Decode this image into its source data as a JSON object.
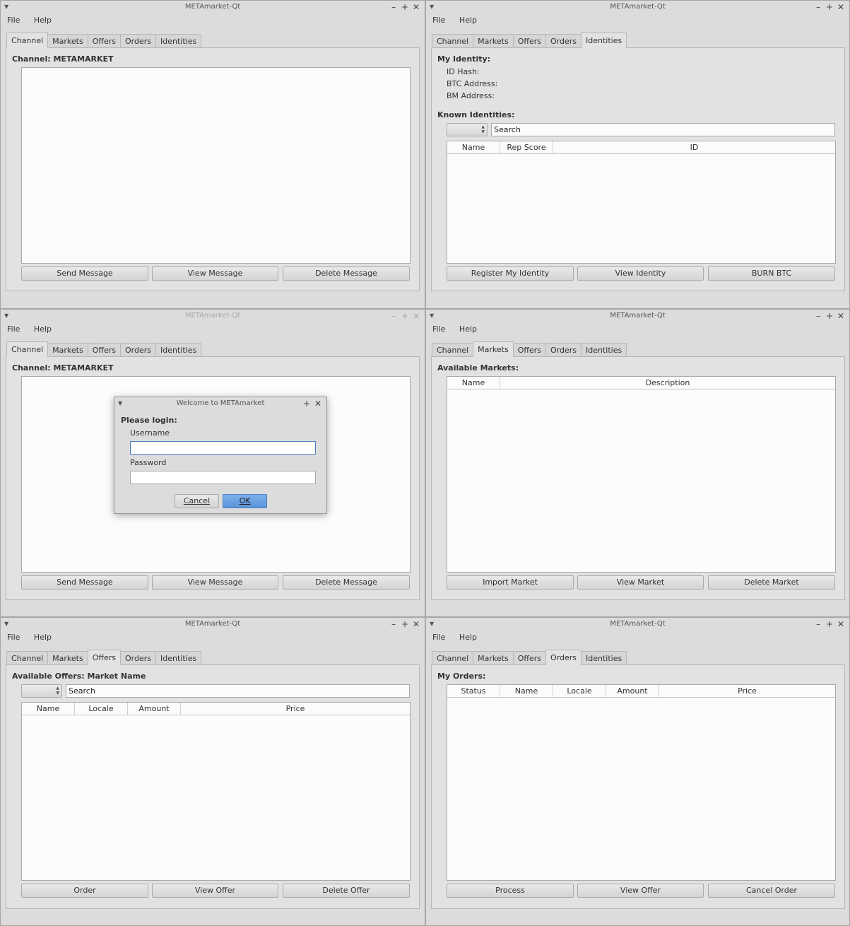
{
  "app_title": "METAmarket-Qt",
  "menu": {
    "file": "File",
    "help": "Help"
  },
  "tabs": {
    "channel": "Channel",
    "markets": "Markets",
    "offers": "Offers",
    "orders": "Orders",
    "identities": "Identities"
  },
  "channel": {
    "title": "Channel: METAMARKET",
    "buttons": {
      "send": "Send Message",
      "view": "View Message",
      "delete": "Delete Message"
    }
  },
  "identities": {
    "my_identity": "My Identity:",
    "id_hash": "ID Hash:",
    "btc_address": "BTC Address:",
    "bm_address": "BM Address:",
    "known": "Known Identities:",
    "search_value": "Search",
    "columns": {
      "name": "Name",
      "rep": "Rep Score",
      "id": "ID"
    },
    "buttons": {
      "register": "Register My Identity",
      "view": "View Identity",
      "burn": "BURN BTC"
    }
  },
  "login_dialog": {
    "title": "Welcome to METAmarket",
    "prompt": "Please login:",
    "username_label": "Username",
    "password_label": "Password",
    "username_value": "",
    "password_value": "",
    "cancel": "Cancel",
    "ok": "OK"
  },
  "markets": {
    "title": "Available Markets:",
    "columns": {
      "name": "Name",
      "description": "Description"
    },
    "buttons": {
      "import": "Import Market",
      "view": "View Market",
      "delete": "Delete Market"
    }
  },
  "offers": {
    "title": "Available Offers: Market Name",
    "search_value": "Search",
    "columns": {
      "name": "Name",
      "locale": "Locale",
      "amount": "Amount",
      "price": "Price"
    },
    "buttons": {
      "order": "Order",
      "view": "View Offer",
      "delete": "Delete Offer"
    }
  },
  "orders": {
    "title": "My Orders:",
    "columns": {
      "status": "Status",
      "name": "Name",
      "locale": "Locale",
      "amount": "Amount",
      "price": "Price"
    },
    "buttons": {
      "process": "Process",
      "view": "View Offer",
      "cancel": "Cancel Order"
    }
  },
  "colors": {
    "window_bg": "#dcdcdc",
    "pane_bg": "#e2e2e2",
    "accent": "#5a93d9"
  },
  "icons": {
    "window_menu": "chevron-down-icon",
    "minimize": "minimize-icon",
    "maximize": "maximize-icon",
    "close": "close-icon"
  }
}
